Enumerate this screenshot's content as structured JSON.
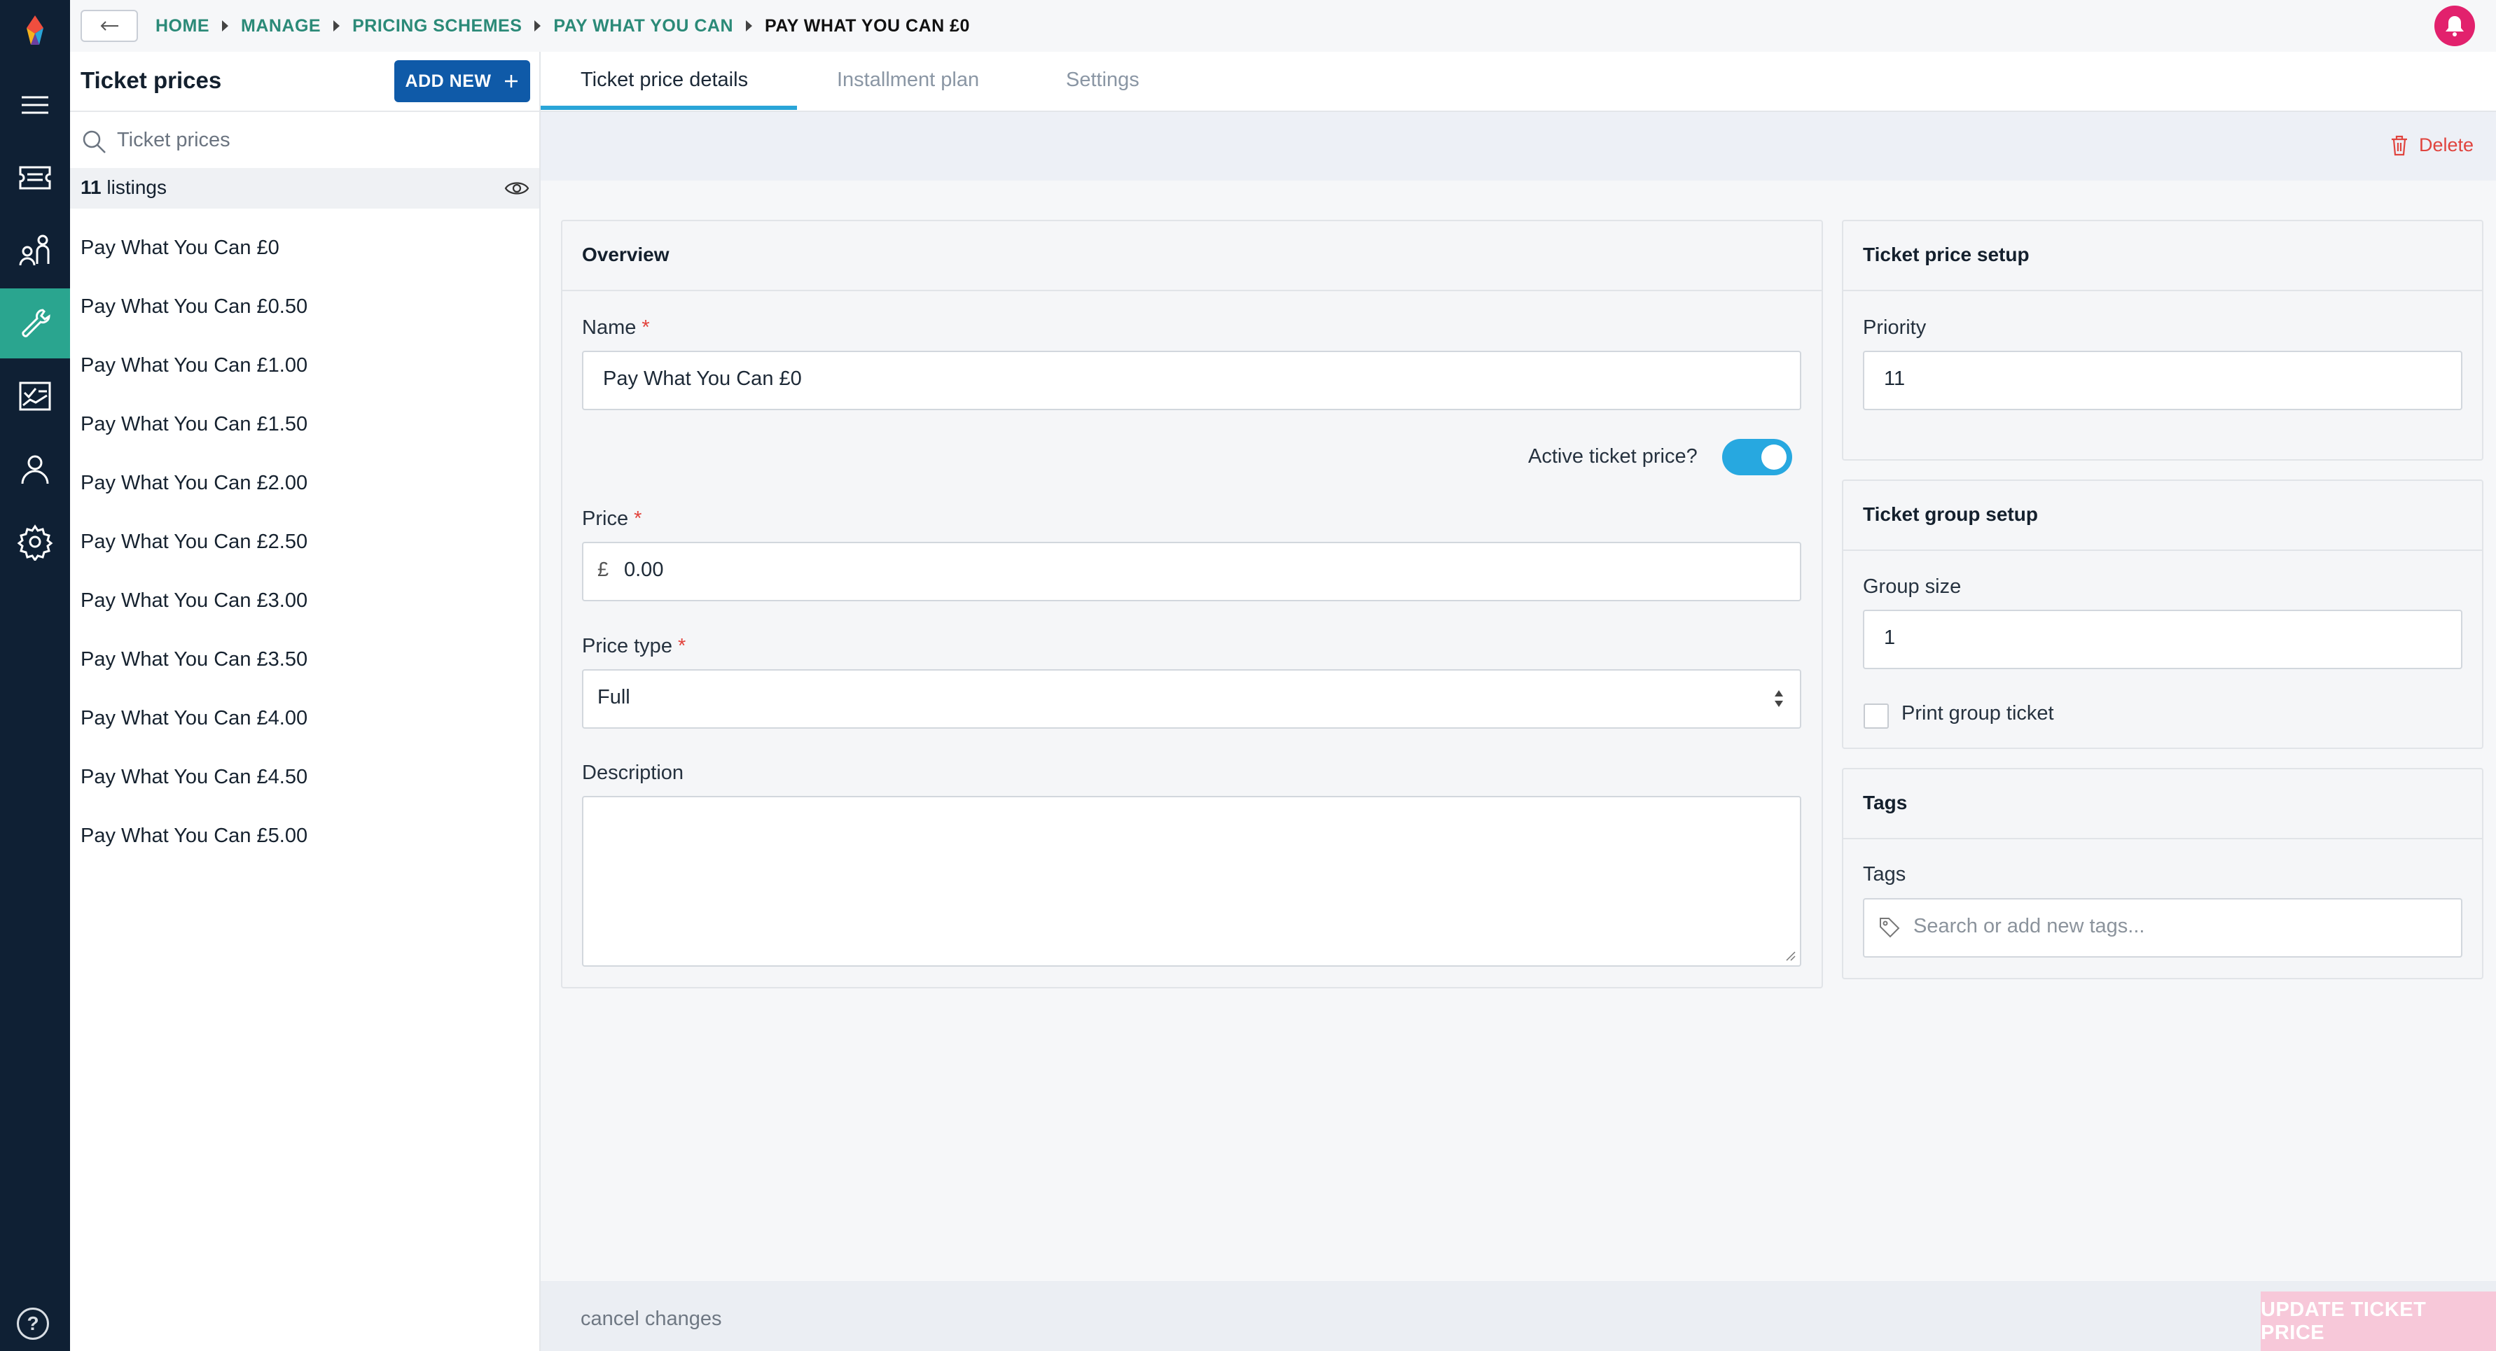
{
  "colors": {
    "rail": "#0f2034",
    "accent_green": "#2aa58f",
    "primary_blue": "#0f5aa8",
    "toggle_blue": "#27a8e0",
    "danger": "#e0443e",
    "notification": "#e2216d"
  },
  "breadcrumb": [
    "HOME",
    "MANAGE",
    "PRICING SCHEMES",
    "PAY WHAT YOU CAN",
    "PAY WHAT YOU CAN £0"
  ],
  "sidebar_nav": [
    {
      "icon": "menu-icon"
    },
    {
      "icon": "ticket-icon"
    },
    {
      "icon": "people-icon"
    },
    {
      "icon": "wrench-icon",
      "active": true
    },
    {
      "icon": "report-icon"
    },
    {
      "icon": "user-icon"
    },
    {
      "icon": "gear-icon"
    }
  ],
  "list_panel": {
    "title": "Ticket prices",
    "add_new_label": "ADD NEW",
    "search_placeholder": "Ticket prices",
    "listings_count": "11",
    "listings_label": "listings",
    "items": [
      "Pay What You Can £0",
      "Pay What You Can £0.50",
      "Pay What You Can £1.00",
      "Pay What You Can £1.50",
      "Pay What You Can £2.00",
      "Pay What You Can £2.50",
      "Pay What You Can £3.00",
      "Pay What You Can £3.50",
      "Pay What You Can £4.00",
      "Pay What You Can £4.50",
      "Pay What You Can £5.00"
    ]
  },
  "tabs": [
    "Ticket price details",
    "Installment plan",
    "Settings"
  ],
  "delete_label": "Delete",
  "overview": {
    "title": "Overview",
    "name_label": "Name",
    "name_value": "Pay What You Can £0",
    "active_label": "Active ticket price?",
    "active": true,
    "price_label": "Price",
    "currency_symbol": "£",
    "price_value": "0.00",
    "price_type_label": "Price type",
    "price_type_value": "Full",
    "description_label": "Description",
    "required_mark": "*"
  },
  "ticket_price_setup": {
    "title": "Ticket price setup",
    "priority_label": "Priority",
    "priority_value": "11"
  },
  "ticket_group_setup": {
    "title": "Ticket group setup",
    "group_size_label": "Group size",
    "group_size_value": "1",
    "print_group_label": "Print group ticket",
    "print_group_checked": false
  },
  "tags": {
    "title": "Tags",
    "label": "Tags",
    "placeholder": "Search or add new tags..."
  },
  "footer": {
    "cancel_label": "cancel changes",
    "update_label": "UPDATE TICKET PRICE"
  },
  "help_glyph": "?"
}
